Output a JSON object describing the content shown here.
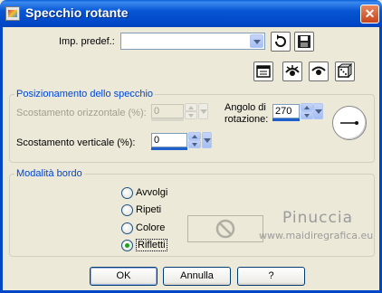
{
  "window": {
    "title": "Specchio rotante",
    "close_glyph": "✕"
  },
  "preset": {
    "label": "Imp. predef.:",
    "value": ""
  },
  "toolbar": {
    "icons": [
      "reset-icon",
      "save-icon",
      "window-icon",
      "eye-icon",
      "eye-closed-icon",
      "dice-icon"
    ]
  },
  "mirror_position": {
    "title": "Posizionamento dello specchio",
    "horizontal_offset": {
      "label": "Scostamento orizzontale (%):",
      "value": "0",
      "enabled": false
    },
    "vertical_offset": {
      "label": "Scostamento verticale (%):",
      "value": "0"
    },
    "rotation_angle": {
      "label_line1": "Angolo di",
      "label_line2": "rotazione:",
      "value": "270"
    }
  },
  "edge_mode": {
    "title": "Modalità bordo",
    "options": [
      "Avvolgi",
      "Ripeti",
      "Colore",
      "Rifletti"
    ],
    "selected": "Rifletti"
  },
  "watermark": {
    "name": "Pinuccia",
    "url": "www.maidiregrafica.eu"
  },
  "buttons": {
    "ok": "OK",
    "cancel": "Annulla",
    "help": "?"
  }
}
